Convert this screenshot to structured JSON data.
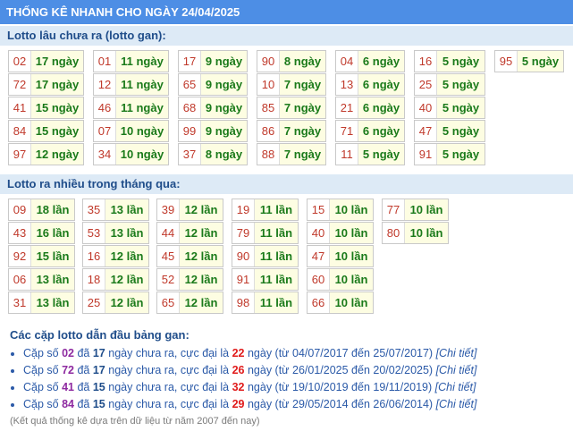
{
  "title": "THỐNG KÊ NHANH CHO NGÀY 24/04/2025",
  "gan": {
    "heading": "Lotto lâu chưa ra (lotto gan):",
    "columns": [
      [
        [
          "02",
          "17 ngày"
        ],
        [
          "72",
          "17 ngày"
        ],
        [
          "41",
          "15 ngày"
        ],
        [
          "84",
          "15 ngày"
        ],
        [
          "97",
          "12 ngày"
        ]
      ],
      [
        [
          "01",
          "11 ngày"
        ],
        [
          "12",
          "11 ngày"
        ],
        [
          "46",
          "11 ngày"
        ],
        [
          "07",
          "10 ngày"
        ],
        [
          "34",
          "10 ngày"
        ]
      ],
      [
        [
          "17",
          "9 ngày"
        ],
        [
          "65",
          "9 ngày"
        ],
        [
          "68",
          "9 ngày"
        ],
        [
          "99",
          "9 ngày"
        ],
        [
          "37",
          "8 ngày"
        ]
      ],
      [
        [
          "90",
          "8 ngày"
        ],
        [
          "10",
          "7 ngày"
        ],
        [
          "85",
          "7 ngày"
        ],
        [
          "86",
          "7 ngày"
        ],
        [
          "88",
          "7 ngày"
        ]
      ],
      [
        [
          "04",
          "6 ngày"
        ],
        [
          "13",
          "6 ngày"
        ],
        [
          "21",
          "6 ngày"
        ],
        [
          "71",
          "6 ngày"
        ],
        [
          "11",
          "5 ngày"
        ]
      ],
      [
        [
          "16",
          "5 ngày"
        ],
        [
          "25",
          "5 ngày"
        ],
        [
          "40",
          "5 ngày"
        ],
        [
          "47",
          "5 ngày"
        ],
        [
          "91",
          "5 ngày"
        ]
      ],
      [
        [
          "95",
          "5 ngày"
        ]
      ]
    ]
  },
  "frequent": {
    "heading": "Lotto ra nhiều trong tháng qua:",
    "columns": [
      [
        [
          "09",
          "18 lần"
        ],
        [
          "43",
          "16 lần"
        ],
        [
          "92",
          "15 lần"
        ],
        [
          "06",
          "13 lần"
        ],
        [
          "31",
          "13 lần"
        ]
      ],
      [
        [
          "35",
          "13 lần"
        ],
        [
          "53",
          "13 lần"
        ],
        [
          "16",
          "12 lần"
        ],
        [
          "18",
          "12 lần"
        ],
        [
          "25",
          "12 lần"
        ]
      ],
      [
        [
          "39",
          "12 lần"
        ],
        [
          "44",
          "12 lần"
        ],
        [
          "45",
          "12 lần"
        ],
        [
          "52",
          "12 lần"
        ],
        [
          "65",
          "12 lần"
        ]
      ],
      [
        [
          "19",
          "11 lần"
        ],
        [
          "79",
          "11 lần"
        ],
        [
          "90",
          "11 lần"
        ],
        [
          "91",
          "11 lần"
        ],
        [
          "98",
          "11 lần"
        ]
      ],
      [
        [
          "15",
          "10 lần"
        ],
        [
          "40",
          "10 lần"
        ],
        [
          "47",
          "10 lần"
        ],
        [
          "60",
          "10 lần"
        ],
        [
          "66",
          "10 lần"
        ]
      ],
      [
        [
          "77",
          "10 lần"
        ],
        [
          "80",
          "10 lần"
        ]
      ]
    ]
  },
  "summary": {
    "heading": "Các cặp lotto dẫn đầu bảng gan:",
    "items": [
      {
        "pair": "02",
        "days": "17",
        "max": "22",
        "from": "04/07/2017",
        "to": "25/07/2017"
      },
      {
        "pair": "72",
        "days": "17",
        "max": "26",
        "from": "26/01/2025",
        "to": "20/02/2025"
      },
      {
        "pair": "41",
        "days": "15",
        "max": "32",
        "from": "19/10/2019",
        "to": "19/11/2019"
      },
      {
        "pair": "84",
        "days": "15",
        "max": "29",
        "from": "29/05/2014",
        "to": "26/06/2014"
      }
    ],
    "words": {
      "pair_prefix": "Cặp số",
      "da": "đã",
      "ngay_chua_ra": "ngày chưa ra, cực đại là",
      "ngay": "ngày",
      "tu": "(từ",
      "den": "đến",
      "close": ")",
      "link": "[Chi tiết]"
    }
  },
  "note": "(Kết quả thống kê dựa trên dữ liệu từ năm 2007 đến nay)"
}
